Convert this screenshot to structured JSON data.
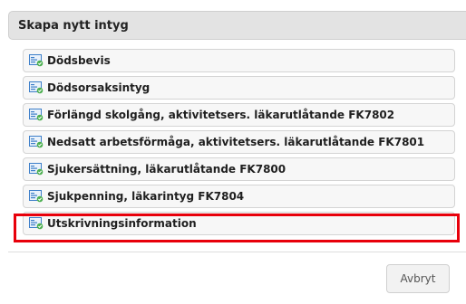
{
  "header": {
    "title": "Skapa nytt intyg"
  },
  "items": [
    {
      "label": "Dödsbevis",
      "icon": "certificate-icon"
    },
    {
      "label": "Dödsorsaksintyg",
      "icon": "certificate-icon"
    },
    {
      "label": "Förlängd skolgång, aktivitetsers. läkarutlåtande FK7802",
      "icon": "certificate-icon"
    },
    {
      "label": "Nedsatt arbetsförmåga, aktivitetsers. läkarutlåtande FK7801",
      "icon": "certificate-icon"
    },
    {
      "label": "Sjukersättning, läkarutlåtande FK7800",
      "icon": "certificate-icon"
    },
    {
      "label": "Sjukpenning, läkarintyg FK7804",
      "icon": "certificate-icon"
    },
    {
      "label": "Utskrivningsinformation",
      "icon": "certificate-icon"
    }
  ],
  "footer": {
    "cancel_label": "Avbryt"
  },
  "colors": {
    "highlight": "#e8000b",
    "icon_blue": "#3d7fc9",
    "icon_green": "#4caf50"
  }
}
